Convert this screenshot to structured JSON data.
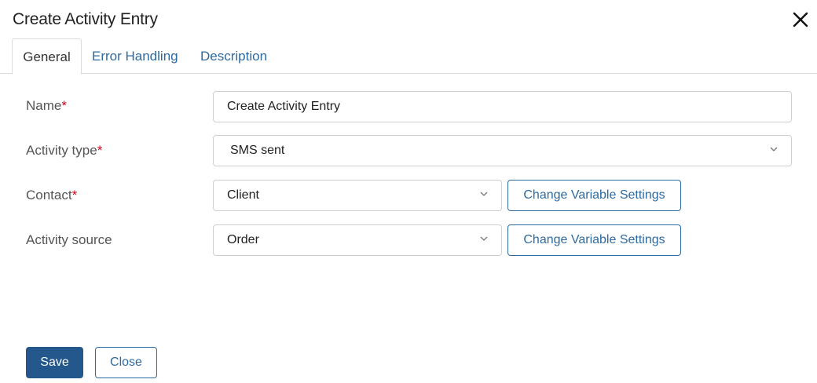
{
  "dialog": {
    "title": "Create Activity Entry",
    "close_icon": "close-icon"
  },
  "tabs": [
    {
      "label": "General",
      "active": true
    },
    {
      "label": "Error Handling",
      "active": false
    },
    {
      "label": "Description",
      "active": false
    }
  ],
  "form": {
    "required_marker": "*",
    "name": {
      "label": "Name",
      "required": true,
      "value": "Create Activity Entry"
    },
    "activity_type": {
      "label": "Activity type",
      "required": true,
      "value": "SMS sent"
    },
    "contact": {
      "label": "Contact",
      "required": true,
      "value": "Client",
      "button": "Change Variable Settings"
    },
    "activity_source": {
      "label": "Activity source",
      "required": false,
      "value": "Order",
      "button": "Change Variable Settings"
    }
  },
  "footer": {
    "save_label": "Save",
    "close_label": "Close"
  },
  "colors": {
    "accent": "#2d6aa0",
    "primary_button": "#24578b",
    "required": "#d0021b",
    "border": "#cfcfcf"
  }
}
